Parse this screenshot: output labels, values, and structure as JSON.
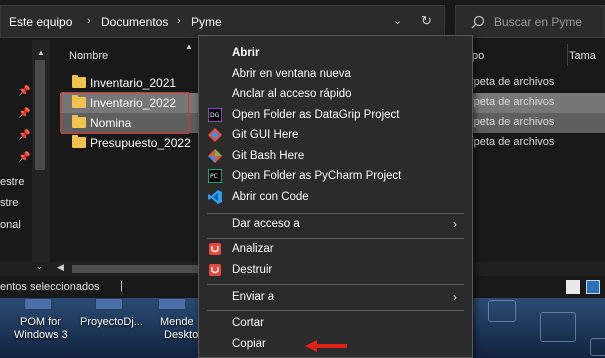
{
  "breadcrumb": [
    "Este equipo",
    "Documentos",
    "Pyme"
  ],
  "breadcrumb_sep": "›",
  "address_icons": {
    "dropdown": "chevron-down-icon",
    "refresh": "refresh-icon"
  },
  "search": {
    "placeholder": "Buscar en Pyme"
  },
  "nav": {
    "labels": [
      "estre",
      "stre",
      "onal"
    ]
  },
  "columns": {
    "name": "Nombre",
    "type": "po",
    "size": "Tama"
  },
  "files": [
    {
      "name": "Inventario_2021",
      "type": "rpeta de archivos",
      "selected": false
    },
    {
      "name": "Inventario_2022",
      "type": "rpeta de archivos",
      "selected": true
    },
    {
      "name": "Nomina",
      "type": "rpeta de archivos",
      "selected": true
    },
    {
      "name": "Presupuesto_2022",
      "type": "rpeta de archivos",
      "selected": false
    }
  ],
  "status": {
    "text": "entos seleccionados",
    "sep": "|"
  },
  "desktop": {
    "items": [
      {
        "label_line1": "POM for",
        "label_line2": "Windows 3"
      },
      {
        "label_line1": "ProyectoDj...",
        "label_line2": ""
      },
      {
        "label_line1": "Mende",
        "label_line2": "Deskto"
      }
    ]
  },
  "context_menu": {
    "items": [
      {
        "label": "Abrir",
        "bold": true,
        "icon": ""
      },
      {
        "label": "Abrir en ventana nueva",
        "bold": false,
        "icon": ""
      },
      {
        "label": "Anclar al acceso rápido",
        "bold": false,
        "icon": ""
      },
      {
        "label": "Open Folder as DataGrip Project",
        "bold": false,
        "icon": "datagrip-icon"
      },
      {
        "label": "Git GUI Here",
        "bold": false,
        "icon": "git-gui-icon"
      },
      {
        "label": "Git Bash Here",
        "bold": false,
        "icon": "git-bash-icon"
      },
      {
        "label": "Open Folder as PyCharm Project",
        "bold": false,
        "icon": "pycharm-icon"
      },
      {
        "label": "Abrir con Code",
        "bold": false,
        "icon": "vscode-icon"
      },
      {
        "label": "Dar acceso a",
        "bold": false,
        "icon": "",
        "submenu": true
      },
      {
        "label": "Analizar",
        "bold": false,
        "icon": "shield-icon"
      },
      {
        "label": "Destruir",
        "bold": false,
        "icon": "shield-icon"
      },
      {
        "label": "Enviar a",
        "bold": false,
        "icon": "",
        "submenu": true
      },
      {
        "label": "Cortar",
        "bold": false,
        "icon": ""
      },
      {
        "label": "Copiar",
        "bold": false,
        "icon": ""
      }
    ],
    "submenu_arrow": "›"
  },
  "colors": {
    "accent_red": "#d9342a",
    "folder": "#f2c24f",
    "menu_bg": "#2b2b2b",
    "selection": "#777777"
  }
}
